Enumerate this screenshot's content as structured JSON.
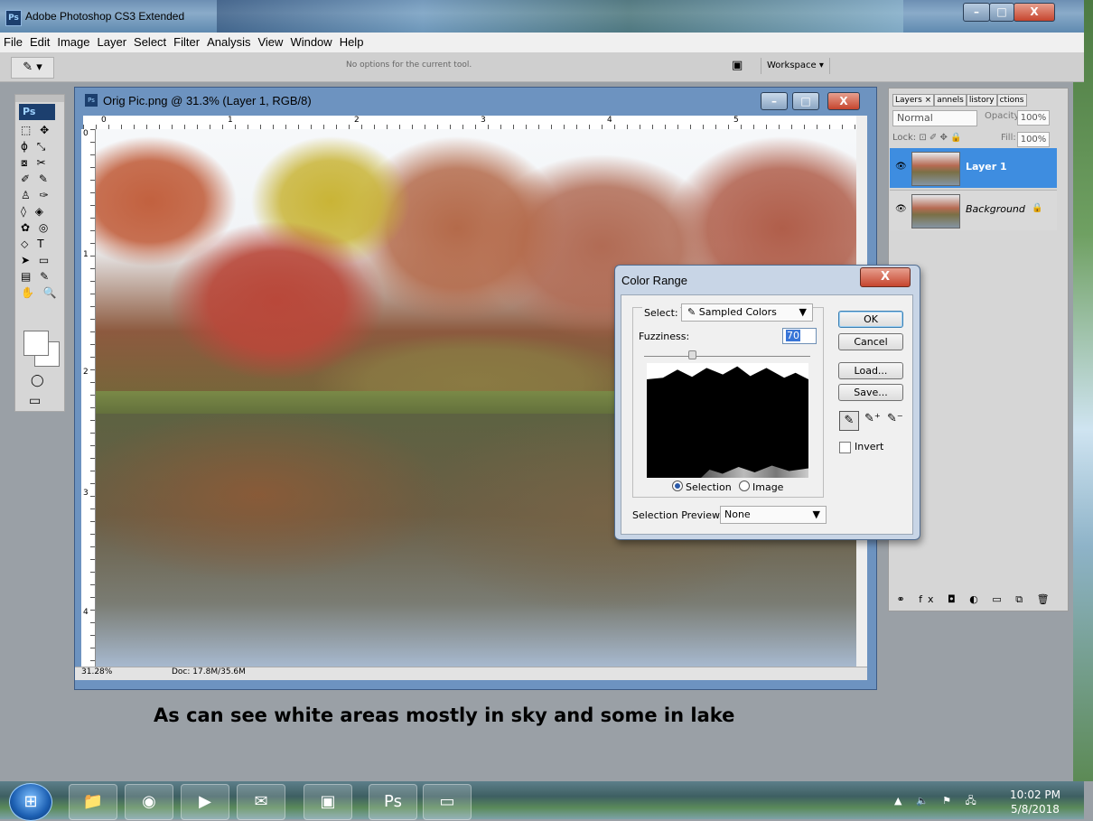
{
  "app": {
    "title": "Adobe Photoshop CS3 Extended",
    "logo": "Ps"
  },
  "window_controls": {
    "minimize": "–",
    "maximize": "□",
    "close": "X"
  },
  "menu": [
    "File",
    "Edit",
    "Image",
    "Layer",
    "Select",
    "Filter",
    "Analysis",
    "View",
    "Window",
    "Help"
  ],
  "options_bar": {
    "tool_icon": "eyedropper-icon",
    "tool_glyph": "✎ ▾",
    "message": "No options for the current tool.",
    "workspace_label": "Workspace ▾"
  },
  "tools_panel": {
    "logo": "Ps",
    "rows": [
      "⬚ ✥",
      "ϕ ⤡",
      "⧇ ✂",
      "✐ ✎",
      "♙ ✑",
      "◊ ◈",
      "✿ ◎",
      "⬦ T",
      "➤ ▭",
      "▤ ✎",
      "✋ 🔍"
    ],
    "quickmask": "◯",
    "screenmode": "▭"
  },
  "document": {
    "icon": "Ps",
    "title": "Orig Pic.png @ 31.3% (Layer 1, RGB/8)",
    "ruler_top": [
      "0",
      "1",
      "2",
      "3",
      "4",
      "5"
    ],
    "ruler_left": [
      "0",
      "1",
      "2",
      "3",
      "4"
    ],
    "zoom": "31.28%",
    "doc_size": "Doc: 17.8M/35.6M"
  },
  "color_range": {
    "title": "Color Range",
    "close": "X",
    "select_label": "Select:",
    "select_value": "Sampled Colors",
    "fuzziness_label": "Fuzziness:",
    "fuzziness_value": "70",
    "fuzziness_level": 70,
    "radio_selection": "Selection",
    "radio_image": "Image",
    "selected_radio": "Selection",
    "preview_label": "Selection Preview:",
    "preview_value": "None",
    "buttons": {
      "ok": "OK",
      "cancel": "Cancel",
      "load": "Load...",
      "save": "Save..."
    },
    "invert_label": "Invert",
    "invert_checked": false
  },
  "layers_panel": {
    "tabs": [
      "Layers ×",
      "annels",
      "listory",
      "ctions"
    ],
    "blend_mode": "Normal",
    "opacity_label": "Opacity:",
    "opacity_value": "100%",
    "lock_label": "Lock:",
    "fill_label": "Fill:",
    "fill_value": "100%",
    "layers": [
      {
        "name": "Layer 1",
        "selected": true
      },
      {
        "name": "Background",
        "selected": false,
        "locked": true
      }
    ],
    "footer_icons": "⚭ fx ◘ ◐ ▭ ⧉ 🗑"
  },
  "caption": "As can see white areas mostly in sky and some in lake",
  "taskbar": {
    "items": [
      "folder-icon",
      "firefox-icon",
      "media-player-icon",
      "mail-icon",
      "powerpoint-icon",
      "photoshop-icon",
      "photo-viewer-icon"
    ],
    "ps_label": "Ps",
    "time": "10:02 PM",
    "date": "5/8/2018"
  }
}
